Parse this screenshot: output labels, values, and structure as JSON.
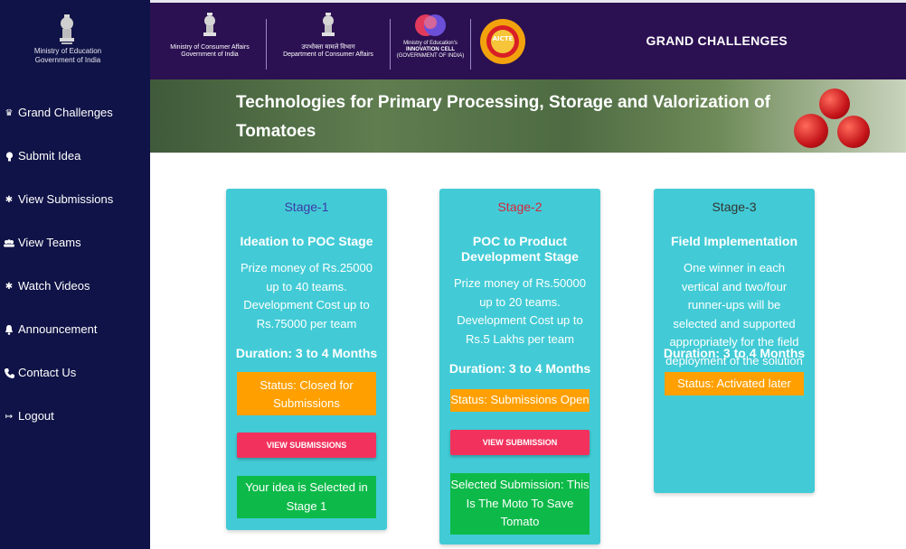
{
  "sidebar": {
    "ministry_line1": "Ministry of Education",
    "ministry_line2": "Government of India",
    "items": [
      {
        "label": "Grand Challenges",
        "icon": "crown-icon"
      },
      {
        "label": "Submit Idea",
        "icon": "bulb-icon"
      },
      {
        "label": "View Submissions",
        "icon": "sparkle-icon"
      },
      {
        "label": "View Teams",
        "icon": "users-icon"
      },
      {
        "label": "Watch Videos",
        "icon": "sparkle-icon"
      },
      {
        "label": "Announcement",
        "icon": "bell-icon"
      },
      {
        "label": "Contact Us",
        "icon": "phone-icon"
      },
      {
        "label": "Logout",
        "icon": "logout-icon"
      }
    ]
  },
  "header": {
    "logo1_line1": "Ministry of Consumer Affairs",
    "logo1_line2": "Government of India",
    "logo2_line1": "उपभोक्ता मामले विभाग",
    "logo2_line2": "Department of Consumer Affairs",
    "logo3_line1": "Ministry of Education's",
    "logo3_line2": "INNOVATION CELL",
    "logo3_line3": "(GOVERNMENT OF INDIA)",
    "logo4_text": "AICTE",
    "title": "GRAND CHALLENGES"
  },
  "banner": {
    "title": "Technologies for Primary Processing, Storage and Valorization of Tomatoes"
  },
  "cards": [
    {
      "stage": "Stage-1",
      "stage_color": "#3d3aa6",
      "title": "Ideation to POC Stage",
      "description": "Prize money of Rs.25000 up to 40 teams. Development Cost up to Rs.75000 per team",
      "duration": "Duration: 3 to 4 Months",
      "status": "Status: Closed for Submissions",
      "button": "VIEW SUBMISSIONS",
      "selection": "Your idea is Selected in Stage 1"
    },
    {
      "stage": "Stage-2",
      "stage_color": "#d7263d",
      "title": "POC to Product Development Stage",
      "description": "Prize money of Rs.50000 up to 20 teams. Development Cost up to Rs.5 Lakhs per team",
      "duration": "Duration: 3 to 4 Months",
      "status": "Status: Submissions Open",
      "button": "VIEW SUBMISSION",
      "selection": "Selected Submission: This Is The Moto To Save Tomato"
    },
    {
      "stage": "Stage-3",
      "stage_color": "#333333",
      "title": "Field Implementation",
      "description": "One winner in each vertical and two/four runner-ups will be selected and supported appropriately for the field deployment of the solution",
      "duration": "Duration: 3 to 4 Months",
      "status": "Status: Activated later"
    }
  ]
}
